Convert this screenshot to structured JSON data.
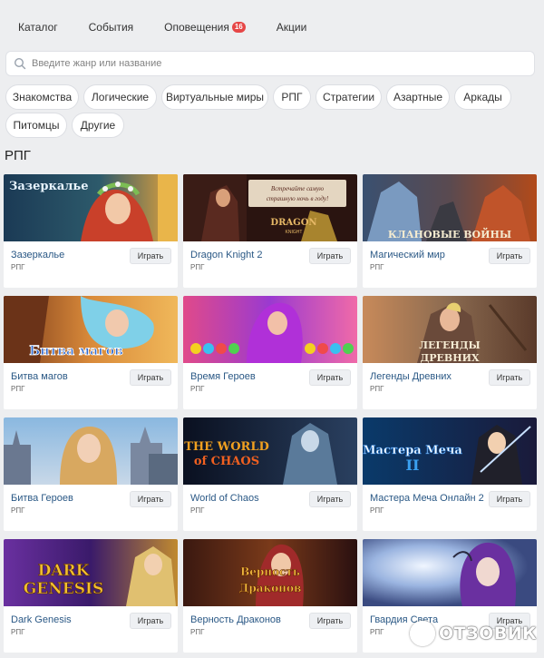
{
  "nav": {
    "catalog": "Каталог",
    "events": "События",
    "notifications": "Оповещения",
    "notifications_count": "16",
    "promotions": "Акции"
  },
  "search": {
    "placeholder": "Введите жанр или название",
    "value": ""
  },
  "chips": [
    "Знакомства",
    "Логические",
    "Виртуальные миры",
    "РПГ",
    "Стратегии",
    "Азартные",
    "Аркады",
    "Питомцы",
    "Другие"
  ],
  "section_title": "РПГ",
  "play_label": "Играть",
  "games": [
    {
      "name": "Зазеркалье",
      "genre": "РПГ",
      "art_text": "Зазеркалье"
    },
    {
      "name": "Dragon Knight 2",
      "genre": "РПГ",
      "art_text": "Встречайте самую страшную ночь в году!"
    },
    {
      "name": "Магический мир",
      "genre": "РПГ",
      "art_text": "КЛАНОВЫЕ ВОЙНЫ"
    },
    {
      "name": "Битва магов",
      "genre": "РПГ",
      "art_text": "Битва магов"
    },
    {
      "name": "Время Героев",
      "genre": "РПГ",
      "art_text": ""
    },
    {
      "name": "Легенды Древних",
      "genre": "РПГ",
      "art_text": "ЛЕГЕНДЫ ДРЕВНИХ"
    },
    {
      "name": "Битва Героев",
      "genre": "РПГ",
      "art_text": ""
    },
    {
      "name": "World of Chaos",
      "genre": "РПГ",
      "art_text": "THE WORLD of CHAOS"
    },
    {
      "name": "Мастера Меча Онлайн 2",
      "genre": "РПГ",
      "art_text": "Мастера Меча"
    },
    {
      "name": "Dark Genesis",
      "genre": "РПГ",
      "art_text": "DARK GENESIS"
    },
    {
      "name": "Верность Драконов",
      "genre": "РПГ",
      "art_text": "Верность Драконов"
    },
    {
      "name": "Гвардия Света",
      "genre": "РПГ",
      "art_text": ""
    }
  ],
  "watermark": "ОТЗОВИК",
  "colors": {
    "link": "#2a5885",
    "badge": "#e64646",
    "background": "#edeef0"
  }
}
